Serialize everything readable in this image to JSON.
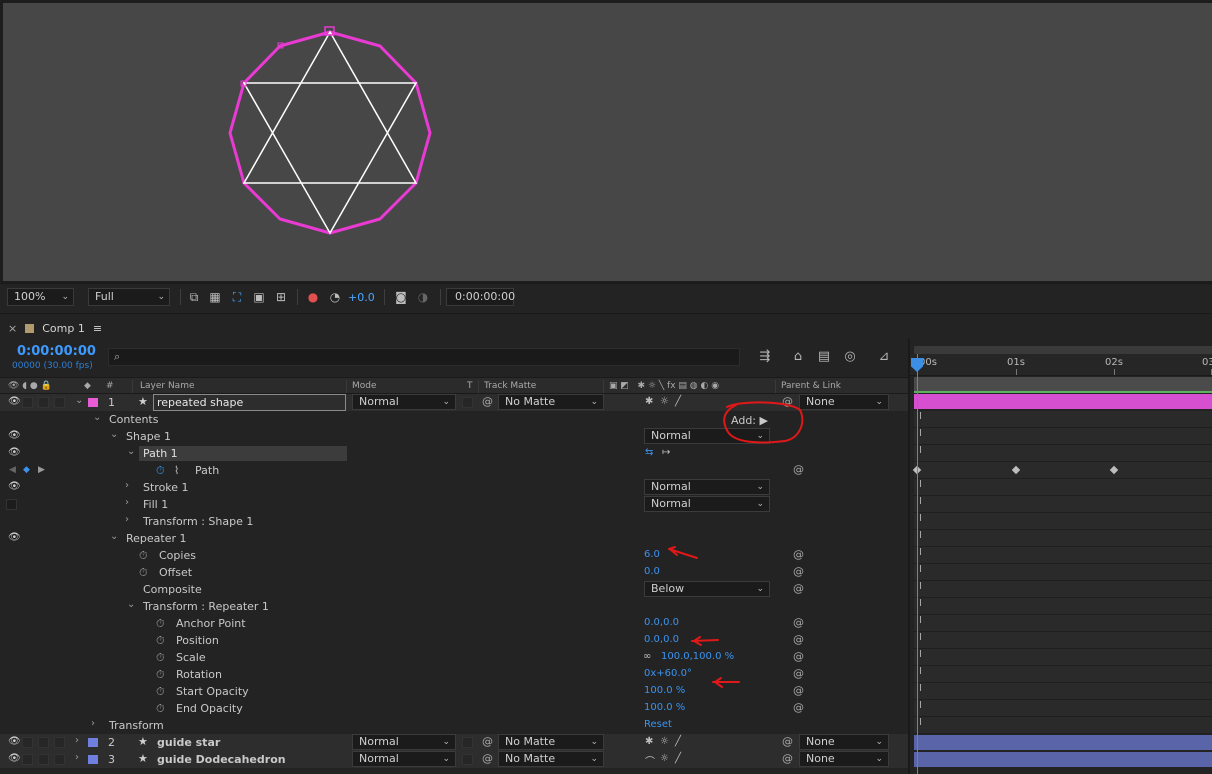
{
  "viewer": {
    "zoom": "100%",
    "resolution": "Full",
    "exposure": "+0.0",
    "timecode": "0:00:00:00"
  },
  "panel": {
    "tab_title": "Comp 1"
  },
  "timecode": {
    "current": "0:00:00:00",
    "frames": "00000 (30.00 fps)"
  },
  "columns": {
    "layer_name": "Layer Name",
    "mode": "Mode",
    "t": "T",
    "track_matte": "Track Matte",
    "parent_link": "Parent & Link",
    "number_sign": "#"
  },
  "colors": {
    "label_pink": "#e85dd6",
    "label_blue": "#6f7fe0",
    "shape_stroke": "#e93ad4",
    "star_stroke": "#ffffff",
    "value_blue": "#3b93ee"
  },
  "layers": {
    "l1": {
      "num": "1",
      "name": "repeated shape",
      "mode": "Normal",
      "matte": "No Matte",
      "parent": "None"
    },
    "l2": {
      "num": "2",
      "name": "guide star",
      "mode": "Normal",
      "matte": "No Matte",
      "parent": "None"
    },
    "l3": {
      "num": "3",
      "name": "guide Dodecahedron",
      "mode": "Normal",
      "matte": "No Matte",
      "parent": "None"
    }
  },
  "props": {
    "contents": "Contents",
    "add_label": "Add:",
    "shape1": "Shape 1",
    "shape1_mode": "Normal",
    "path1": "Path 1",
    "path": "Path",
    "stroke1": "Stroke 1",
    "stroke1_mode": "Normal",
    "fill1": "Fill 1",
    "fill1_mode": "Normal",
    "transform_shape1": "Transform : Shape 1",
    "repeater1": "Repeater 1",
    "copies": "Copies",
    "copies_val": "6.0",
    "offset": "Offset",
    "offset_val": "0.0",
    "composite": "Composite",
    "composite_val": "Below",
    "transform_repeater1": "Transform : Repeater 1",
    "anchor_point": "Anchor Point",
    "anchor_val": "0.0,0.0",
    "position": "Position",
    "position_val": "0.0,0.0",
    "scale": "Scale",
    "scale_val": "100.0,100.0 %",
    "rotation": "Rotation",
    "rotation_val": "0x+60.0°",
    "start_opacity": "Start Opacity",
    "start_opacity_val": "100.0 %",
    "end_opacity": "End Opacity",
    "end_opacity_val": "100.0 %",
    "transform": "Transform",
    "reset": "Reset"
  },
  "ruler": {
    "t0": "00s",
    "t1": "01s",
    "t2": "02s",
    "t3": "03"
  }
}
